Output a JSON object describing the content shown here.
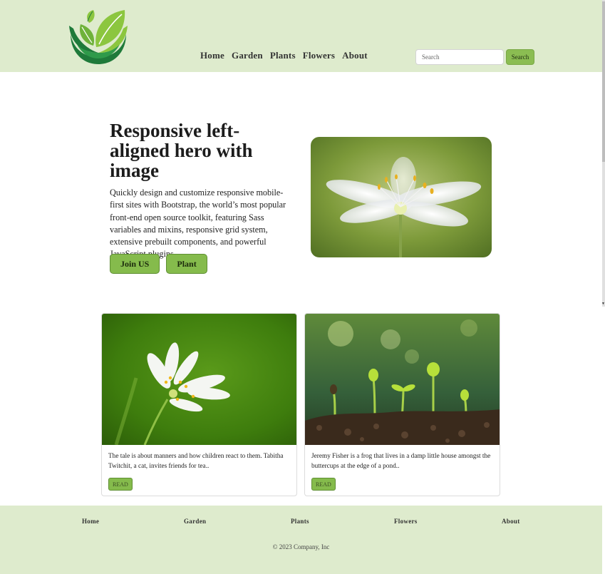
{
  "header": {
    "nav": [
      "Home",
      "Garden",
      "Plants",
      "Flowers",
      "About"
    ],
    "search": {
      "placeholder": "Search",
      "value": "",
      "button_label": "Search"
    }
  },
  "hero": {
    "title": "Responsive left-aligned hero with image",
    "text": "Quickly design and customize responsive mobile-first sites with Bootstrap, the world’s most popular front-end open source toolkit, featuring Sass variables and mixins, responsive grid system, extensive prebuilt components, and powerful JavaScript plugins.",
    "buttons": [
      "Join US",
      "Plant"
    ]
  },
  "cards": [
    {
      "text": "The tale is about manners and how children react to them. Tabitha Twitchit, a cat, invites friends for tea..",
      "button_label": "READ"
    },
    {
      "text": "Jeremy Fisher is a frog that lives in a damp little house amongst the buttercups at the edge of a pond..",
      "button_label": "READ"
    }
  ],
  "footer": {
    "nav": [
      "Home",
      "Garden",
      "Plants",
      "Flowers",
      "About"
    ],
    "copyright": "© 2023 Company, Inc"
  },
  "colors": {
    "header_bg": "#deebcd",
    "accent_green": "#85bb4c",
    "logo_dark": "#1f7a3a",
    "logo_light": "#8cc63f"
  }
}
